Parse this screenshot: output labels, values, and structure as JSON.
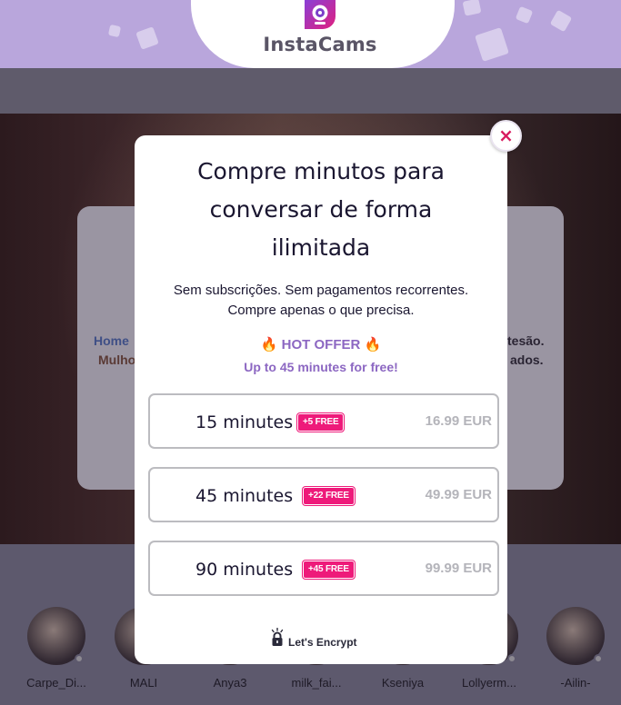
{
  "app": {
    "brand": "InstaCams"
  },
  "background": {
    "hero_link": "Home",
    "hero_sub": "Mulho",
    "hero_right_1": "tesão.",
    "hero_right_2": "ados."
  },
  "models": [
    {
      "name": "Carpe_Di..."
    },
    {
      "name": "MALI"
    },
    {
      "name": "Anya3"
    },
    {
      "name": "milk_fai..."
    },
    {
      "name": "Kseniya"
    },
    {
      "name": "Lollyerm..."
    },
    {
      "name": "-Ailin-"
    }
  ],
  "modal": {
    "title_lines": [
      "Compre minutos para",
      "conversar de forma",
      "ilimitada"
    ],
    "subtitle_lines": [
      "Sem subscrições. Sem pagamentos recorrentes.",
      "Compre apenas o que precisa."
    ],
    "hot_offer": "HOT OFFER",
    "hot_offer_sub": "Up to 45 minutes for free!",
    "close_label": "×",
    "options": [
      {
        "minutes": "15 minutes",
        "badge": "+5 FREE",
        "price": "16.99 EUR"
      },
      {
        "minutes": "45 minutes",
        "badge": "+22 FREE",
        "price": "49.99 EUR"
      },
      {
        "minutes": "90 minutes",
        "badge": "+45 FREE",
        "price": "99.99 EUR"
      }
    ],
    "security_label": "Let's Encrypt"
  },
  "colors": {
    "header_bg": "#b9a6dc",
    "accent_purple": "#8c67c2",
    "badge_pink": "#ee1a7a",
    "close_pink": "#d81b60",
    "price_grey": "#b4b4ba"
  },
  "icons": {
    "close": "close-icon",
    "fire": "fire-icon",
    "lock": "lock-icon",
    "logo": "webcam-logo-icon"
  }
}
